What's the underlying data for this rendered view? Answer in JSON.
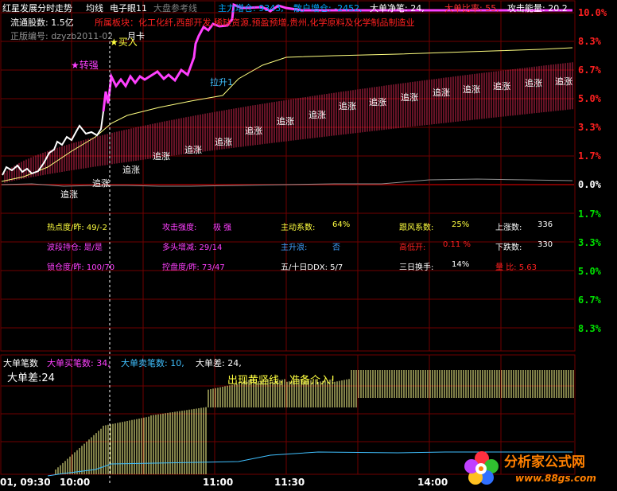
{
  "header": {
    "title": "红星发展分时走势",
    "items": [
      {
        "text": "均线",
        "color": "#ffffff"
      },
      {
        "text": "电子眼11",
        "color": "#ffffff"
      },
      {
        "text": "大盘参考线",
        "color": "#808080"
      },
      {
        "text": "主力增仓: 9343,",
        "color": "#00a8ff"
      },
      {
        "text": "散户增仓: -2452,",
        "color": "#00a8ff"
      },
      {
        "text": "大单净笔: 24,",
        "color": "#ffffff"
      },
      {
        "text": "大单比率: 55,",
        "color": "#ff3030"
      },
      {
        "text": "攻击能量: 20.2",
        "color": "#ffffff"
      }
    ]
  },
  "info": {
    "float_shares": "流通股数: 1.5亿",
    "sector": "所属板块：化工化纤,西部开发,稀缺资源,预盈预增,贵州,化学原料及化学制品制造业",
    "edition": "正版编号: dzyzb2011-02",
    "card": "月卡"
  },
  "signals": {
    "buy": "★买入",
    "turn_strong": "★转强",
    "lift": "拉升1",
    "chase": "追涨"
  },
  "right_axis": [
    {
      "label": "10.0%",
      "color": "#ff2020"
    },
    {
      "label": "8.3%",
      "color": "#ff2020"
    },
    {
      "label": "6.7%",
      "color": "#ff2020"
    },
    {
      "label": "5.0%",
      "color": "#ff2020"
    },
    {
      "label": "3.3%",
      "color": "#ff2020"
    },
    {
      "label": "1.7%",
      "color": "#ff2020"
    },
    {
      "label": "0.0%",
      "color": "#ffffff"
    },
    {
      "label": "1.7%",
      "color": "#00e000"
    },
    {
      "label": "3.3%",
      "color": "#00e000"
    },
    {
      "label": "5.0%",
      "color": "#00e000"
    },
    {
      "label": "6.7%",
      "color": "#00e000"
    },
    {
      "label": "8.3%",
      "color": "#00e000"
    }
  ],
  "stats": [
    {
      "label": "热点度/昨: 49/-2",
      "color": "#ffff40"
    },
    {
      "label": "攻击强度:",
      "color": "#ff40ff"
    },
    {
      "label": "极 强",
      "color": "#ff40ff"
    },
    {
      "label": "主动系数:",
      "color": "#ffff40"
    },
    {
      "label": "64%",
      "color": "#ffff40"
    },
    {
      "label": "跟风系数:",
      "color": "#ffff40"
    },
    {
      "label": "25%",
      "color": "#ffff40"
    },
    {
      "label": "上涨数:",
      "color": "#ffffff"
    },
    {
      "label": "336",
      "color": "#ffffff"
    },
    {
      "label": "波段持仓: 是/是",
      "color": "#ff40ff"
    },
    {
      "label": "多头增减: 29/14",
      "color": "#ff40ff"
    },
    {
      "label": "主升浪:",
      "color": "#40a0ff"
    },
    {
      "label": "否",
      "color": "#40a0ff"
    },
    {
      "label": "高低开:",
      "color": "#ff2020"
    },
    {
      "label": "0.11 %",
      "color": "#ff2020"
    },
    {
      "label": "下跌数:",
      "color": "#ffffff"
    },
    {
      "label": "330",
      "color": "#ffffff"
    },
    {
      "label": "锁仓度/昨: 100/70",
      "color": "#ff40ff"
    },
    {
      "label": "控盘度/昨: 73/47",
      "color": "#ff40ff"
    },
    {
      "label": "五/十日DDX: 5/7",
      "color": "#ffffff"
    },
    {
      "label": "三日换手:",
      "color": "#ffffff"
    },
    {
      "label": "14%",
      "color": "#ffffff"
    },
    {
      "label": "量  比: 5.63",
      "color": "#ff2020"
    }
  ],
  "bottom": {
    "title": "大单笔数",
    "buy_count": "大单买笔数: 34,",
    "sell_count": "大单卖笔数: 10,",
    "diff_inline": "大单差: 24,",
    "diff_label": "大单差:24",
    "message": "出现黄竖线，准备介入!"
  },
  "time_axis": [
    "01, 09:30",
    "10:00",
    "11:00",
    "11:30",
    "14:00"
  ],
  "watermark": {
    "name": "分析家公式网",
    "url": "www.88gs.com"
  },
  "colors": {
    "price_line": "#ffffff",
    "avg_line": "#ffff80",
    "bullish_line": "#ff40ff",
    "chase_band": "#ff3060",
    "bar_volume": "#ffff90",
    "grid": "#700000"
  }
}
